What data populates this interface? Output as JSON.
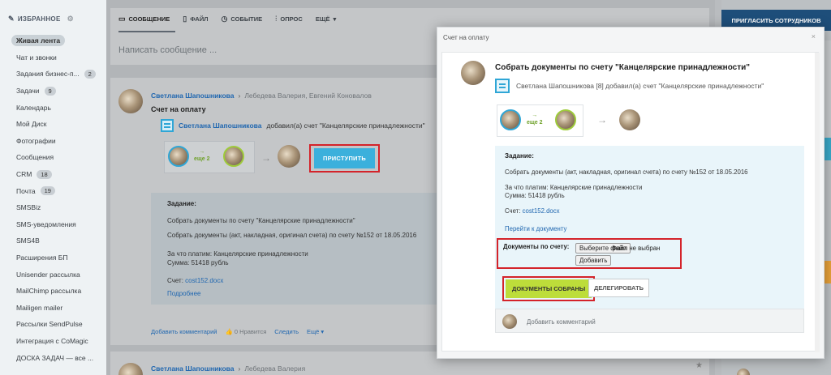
{
  "sidebar": {
    "favorites_label": "ИЗБРАННОЕ",
    "items": [
      {
        "label": "Живая лента",
        "active": true,
        "count": ""
      },
      {
        "label": "Чат и звонки",
        "count": ""
      },
      {
        "label": "Задания бизнес-п...",
        "count": "2"
      },
      {
        "label": "Задачи",
        "count": "9"
      },
      {
        "label": "Календарь",
        "count": ""
      },
      {
        "label": "Мой Диск",
        "count": ""
      },
      {
        "label": "Фотографии",
        "count": ""
      },
      {
        "label": "Сообщения",
        "count": ""
      },
      {
        "label": "CRM",
        "count": "18"
      },
      {
        "label": "Почта",
        "count": "19"
      },
      {
        "label": "SMSBiz",
        "count": ""
      },
      {
        "label": "SMS-уведомления",
        "count": ""
      },
      {
        "label": "SMS4B",
        "count": ""
      },
      {
        "label": "Расширения БП",
        "count": ""
      },
      {
        "label": "Unisender рассылка",
        "count": ""
      },
      {
        "label": "MailChimp рассылка",
        "count": ""
      },
      {
        "label": "Mailigen mailer",
        "count": ""
      },
      {
        "label": "Рассылки SendPulse",
        "count": ""
      },
      {
        "label": "Интеграция с CoMagic",
        "count": ""
      },
      {
        "label": "ДОСКА ЗАДАЧ — все ...",
        "count": ""
      }
    ]
  },
  "compose": {
    "tabs": [
      {
        "icon": "message-icon",
        "glyph": "▭",
        "label": "СООБЩЕНИЕ"
      },
      {
        "icon": "file-icon",
        "glyph": "▯",
        "label": "ФАЙЛ"
      },
      {
        "icon": "alarm-icon",
        "glyph": "◷",
        "label": "СОБЫТИЕ"
      },
      {
        "icon": "poll-icon",
        "glyph": "⫶",
        "label": "ОПРОС"
      },
      {
        "icon": "chevron-down-icon",
        "glyph": "▾",
        "label": "ЕЩЁ"
      }
    ],
    "placeholder": "Написать сообщение ..."
  },
  "post": {
    "author": "Светлана Шапошникова",
    "recipients": "Лебедева Валерия, Евгений Коновалов",
    "title": "Счет на оплату",
    "action_author": "Светлана Шапошникова",
    "action_text": "добавил(а) счет \"Канцелярские принадлежности\"",
    "flow_text_top": "→",
    "flow_text_bottom": "еще 2",
    "start_button": "ПРИСТУПИТЬ",
    "task_header": "Задание:",
    "task_line1": "Собрать документы по счету \"Канцелярские принадлежности\"",
    "task_line2": "Собрать документы (акт, накладная, оригинал счета) по счету №152 от 18.05.2016",
    "task_line3": "За что платим: Канцелярские принадлежности",
    "task_line4": "Сумма: 51418 рубль",
    "invoice_label": "Счет:",
    "invoice_file": "cost152.docx",
    "more_link": "Подробнее",
    "actions": {
      "comment": "Добавить комментарий",
      "likes": "0 Нравится",
      "follow": "Следить",
      "more": "Ещё"
    }
  },
  "post2": {
    "author": "Светлана Шапошникова",
    "recipients": "Лебедева Валерия"
  },
  "right": {
    "invite_button": "ПРИГЛАСИТЬ СОТРУДНИКОВ"
  },
  "modal": {
    "title": "Счет на оплату",
    "close_glyph": "×",
    "task_title": "Собрать документы по счету \"Канцелярские принадлежности\"",
    "action_text": "Светлана Шапошникова [8] добавил(а) счет \"Канцелярские принадлежности\"",
    "flow_text_top": "→",
    "flow_text_bottom": "еще 2",
    "task_header": "Задание:",
    "task_line1": "Собрать документы (акт, накладная, оригинал счета) по счету №152 от 18.05.2016",
    "task_line2": "За что платим: Канцелярские принадлежности",
    "task_line3": "Сумма: 51418 рубль",
    "invoice_label": "Счет:",
    "invoice_file": "cost152.docx",
    "goto_doc": "Перейти к документу",
    "docs_label": "Документы по счету:",
    "choose_file": "Выберите файл",
    "no_file": "Файл не выбран",
    "add_button": "Добавить",
    "done_button": "ДОКУМЕНТЫ СОБРАНЫ",
    "delegate_button": "ДЕЛЕГИРОВАТЬ",
    "comment_placeholder": "Добавить комментарий"
  }
}
